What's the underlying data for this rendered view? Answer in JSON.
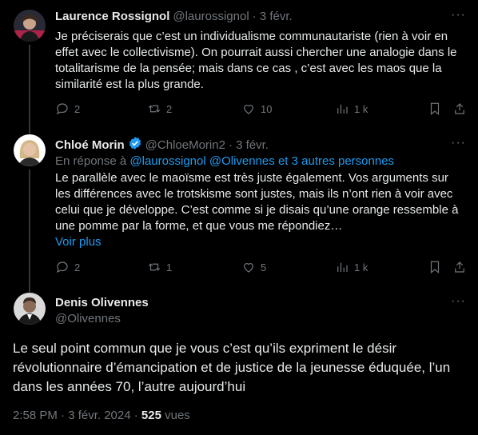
{
  "tweets": [
    {
      "name": "Laurence Rossignol",
      "handle": "@laurossignol",
      "date": "· 3 févr.",
      "body": "Je préciserais que c’est un individualisme communautariste (rien à voir en effet avec le collectivisme). On pourrait aussi chercher une analogie dans le totalitarisme de la pensée; mais dans ce cas , c’est avec les maos que la similarité est la plus grande.",
      "replies": "2",
      "reposts": "2",
      "likes": "10",
      "views": "1 k"
    },
    {
      "name": "Chloé Morin",
      "handle": "@ChloeMorin2",
      "date": "· 3 févr.",
      "reply_prefix": "En réponse à",
      "reply_to": "@laurossignol @Olivennes  et 3 autres personnes",
      "body": "Le parallèle avec le maoïsme est très juste également. Vos arguments sur les différences avec le trotskisme sont justes, mais ils n’ont rien à voir avec celui que je développe. C’est comme si je disais qu’une orange ressemble à une pomme par la forme, et que vous me répondiez…",
      "show_more": "Voir plus",
      "replies": "2",
      "reposts": "1",
      "likes": "5",
      "views": "1 k"
    }
  ],
  "main": {
    "name": "Denis Olivennes",
    "handle": "@Olivennes",
    "body": "Le seul point commun que je vous c’est qu’ils expriment le désir révolutionnaire d’émancipation et de justice de la jeunesse éduquée, l’un dans les années 70, l’autre aujourd’hui",
    "time": "2:58 PM · 3 févr. 2024 ·",
    "views_count": "525",
    "views_label": "vues"
  },
  "more_label": "···",
  "colors": {
    "accent": "#1d9bf0",
    "muted": "#71767b",
    "text": "#e7e9ea",
    "bg": "#000000"
  }
}
